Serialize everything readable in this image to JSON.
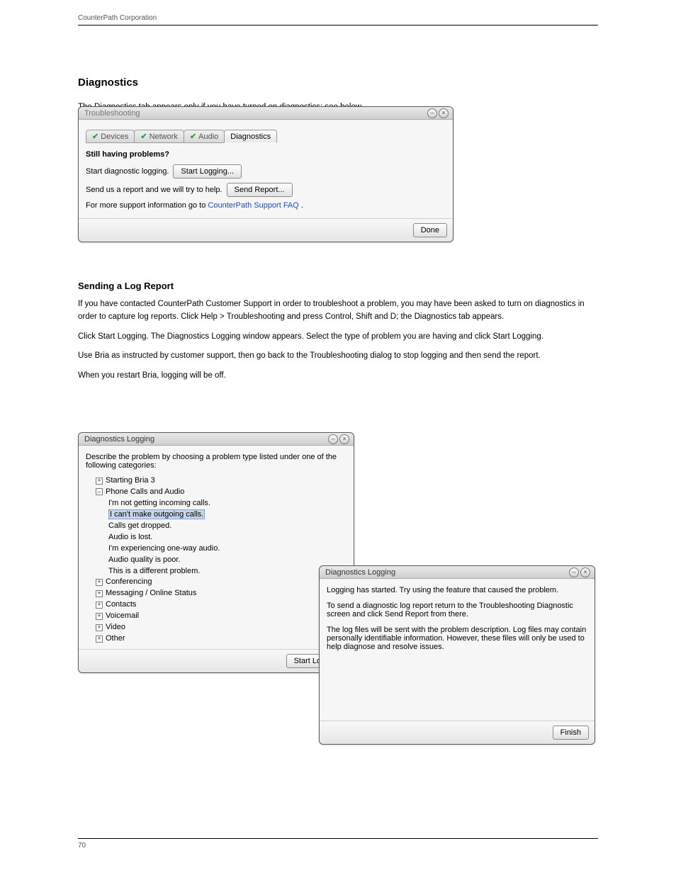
{
  "header": {
    "left": "CounterPath Corporation",
    "right": ""
  },
  "footer": {
    "left": "70",
    "right": ""
  },
  "section": {
    "title": "Diagnostics",
    "intro": "The Diagnostics tab appears only if you have turned on diagnostics; see below.",
    "sub": "Sending a Log Report"
  },
  "para": {
    "p1": "If you have contacted CounterPath Customer Support in order to troubleshoot a problem, you may have been asked to turn on diagnostics in order to capture log reports. Click Help > Troubleshooting and press Control, Shift and D; the Diagnostics tab appears.",
    "p2_a": "Click ",
    "p2_b": "Start Logging",
    "p2_c": ". The Diagnostics Logging window appears. Select the type of problem you are having and click Start Logging.",
    "p3": "Use Bria as instructed by customer support, then go back to the Troubleshooting dialog to stop logging and then send the report.",
    "p4": "When you restart Bria, logging will be off."
  },
  "troubleshoot": {
    "title": "Troubleshooting",
    "tabs": {
      "devices": "Devices",
      "network": "Network",
      "audio": "Audio",
      "diagnostics": "Diagnostics"
    },
    "heading": "Still having problems?",
    "line1_text": "Start diagnostic logging.",
    "line1_btn": "Start Logging...",
    "line2_text": "Send us a report and we will try to help.",
    "line2_btn": "Send Report...",
    "line3_prefix": "For more support information go to ",
    "line3_link": "CounterPath Support FAQ",
    "line3_suffix": " .",
    "done": "Done"
  },
  "diag1": {
    "title": "Diagnostics Logging",
    "prompt": "Describe the problem by choosing a problem type listed under one of the following categories:",
    "tree": {
      "n1": "Starting Bria 3",
      "n2": "Phone Calls and Audio",
      "c1": "I'm not getting incoming calls.",
      "c2": "I can't make outgoing calls.",
      "c3": "Calls get dropped.",
      "c4": "Audio is lost.",
      "c5": "I'm experiencing one-way audio.",
      "c6": "Audio quality is poor.",
      "c7": "This is a different problem.",
      "n3": "Conferencing",
      "n4": "Messaging / Online Status",
      "n5": "Contacts",
      "n6": "Voicemail",
      "n7": "Video",
      "n8": "Other"
    },
    "start": "Start Logging"
  },
  "diag2": {
    "title": "Diagnostics Logging",
    "p1": "Logging has started. Try using the feature that caused the problem.",
    "p2": "To send a diagnostic log report return to the Troubleshooting Diagnostic screen and click Send Report from there.",
    "p3": "The log files will be sent with the problem description. Log files may contain personally identifiable information. However, these files will only be used to help diagnose and resolve issues.",
    "finish": "Finish"
  }
}
